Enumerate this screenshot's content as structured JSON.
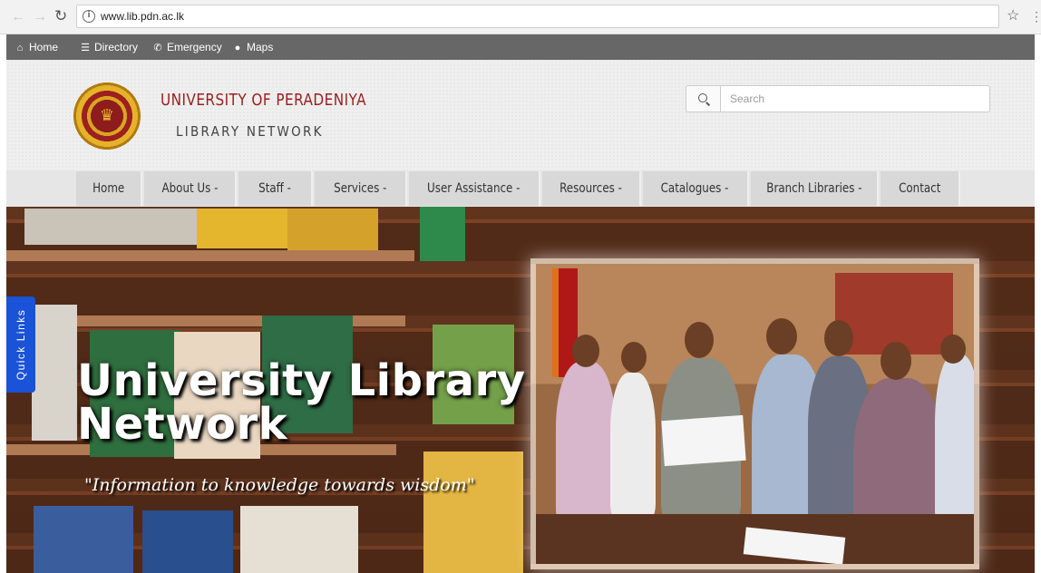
{
  "browser": {
    "url": "www.lib.pdn.ac.lk",
    "back_icon": "back-arrow-icon",
    "forward_icon": "forward-arrow-icon",
    "reload_icon": "reload-icon",
    "bookmark_icon": "star-icon"
  },
  "utility_bar": {
    "items": [
      {
        "label": "Home",
        "icon": "home-icon"
      },
      {
        "label": "Directory",
        "icon": "directory-icon"
      },
      {
        "label": "Emergency",
        "icon": "phone-icon"
      },
      {
        "label": "Maps",
        "icon": "map-marker-icon"
      }
    ]
  },
  "header": {
    "university_name": "UNIVERSITY OF PERADENIYA",
    "subtitle": "LIBRARY NETWORK",
    "search_placeholder": "Search"
  },
  "main_nav": {
    "items": [
      {
        "label": "Home"
      },
      {
        "label": "About Us -"
      },
      {
        "label": "Staff -"
      },
      {
        "label": "Services -"
      },
      {
        "label": "User Assistance -"
      },
      {
        "label": "Resources -"
      },
      {
        "label": "Catalogues -"
      },
      {
        "label": "Branch Libraries -"
      },
      {
        "label": "Contact"
      }
    ]
  },
  "hero": {
    "title_line1": "University Library",
    "title_line2": "Network",
    "tagline": "\"Information to knowledge towards wisdom\""
  },
  "quick_links": {
    "label": "Quick Links"
  },
  "colors": {
    "utility_bar": "#676767",
    "brand_red": "#9a1f1f",
    "nav_item": "#d8d8d8",
    "quick_links": "#1a52d8"
  }
}
